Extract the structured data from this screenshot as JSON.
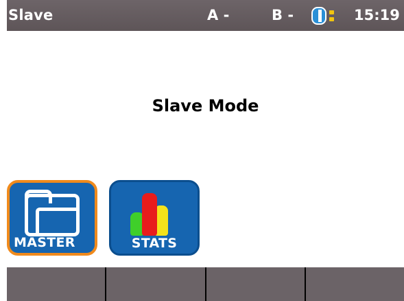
{
  "statusbar": {
    "title": "Slave",
    "port_a": "A -",
    "port_b": "B -",
    "time": "15:19",
    "battery_icon": "battery-icon",
    "battery_color": "#2a8fd6",
    "battery_indicator_color": "#f1c40f"
  },
  "main": {
    "message": "Slave Mode"
  },
  "tiles": [
    {
      "label": "MASTER",
      "icon": "folder-icon",
      "selected": true,
      "highlight_color": "#f08a1c"
    },
    {
      "label": "STATS",
      "icon": "bar-chart-icon",
      "selected": false
    }
  ],
  "softkeys": [
    {
      "label": ""
    },
    {
      "label": ""
    },
    {
      "label": ""
    },
    {
      "label": ""
    }
  ],
  "colors": {
    "statusbar": "#5e5558",
    "tile": "#1665b0",
    "softkey_bar": "#6b6367"
  }
}
